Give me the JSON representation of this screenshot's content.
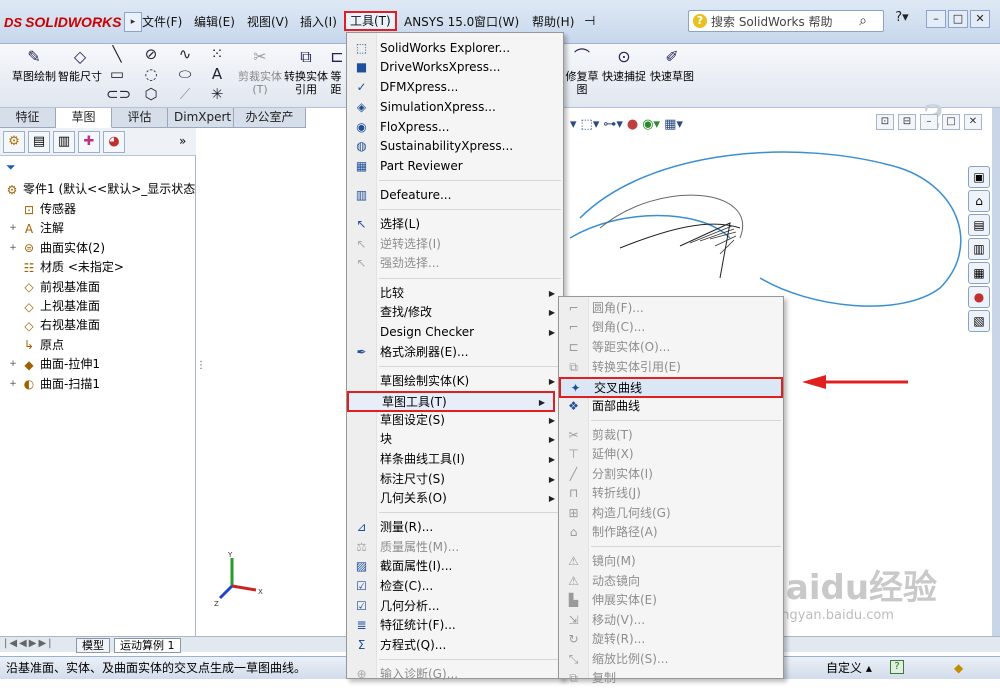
{
  "app": {
    "logo_text": "SOLIDWORKS",
    "logo_mark": "DS"
  },
  "menubar": {
    "items": [
      "文件(F)",
      "编辑(E)",
      "视图(V)",
      "插入(I)",
      "工具(T)",
      "ANSYS 15.0",
      "窗口(W)",
      "帮助(H)"
    ],
    "search_placeholder": "搜索 SolidWorks 帮助"
  },
  "command_manager": {
    "tools": [
      {
        "label": "草图绘制",
        "icon": "sketch-icon"
      },
      {
        "label": "智能尺寸",
        "icon": "smart-dimension-icon"
      },
      {
        "label": "剪裁实体(T)",
        "icon": "trim-icon"
      },
      {
        "label": "转换实体引用",
        "icon": "convert-icon"
      },
      {
        "label": "等距",
        "icon": "offset-icon"
      },
      {
        "label": "修复草图",
        "icon": "repair-sketch-icon"
      },
      {
        "label": "快速捕捉",
        "icon": "quick-snap-icon"
      },
      {
        "label": "快速草图",
        "icon": "rapid-sketch-icon"
      }
    ]
  },
  "tabs": [
    "特征",
    "草图",
    "评估",
    "DimXpert",
    "办公室产品"
  ],
  "active_tab": "草图",
  "feature_tree": {
    "root": "零件1 (默认<<默认>_显示状态",
    "items": [
      {
        "label": "传感器",
        "expand": ""
      },
      {
        "label": "注解",
        "expand": "+"
      },
      {
        "label": "曲面实体(2)",
        "expand": "+"
      },
      {
        "label": "材质 <未指定>",
        "expand": ""
      },
      {
        "label": "前视基准面",
        "expand": ""
      },
      {
        "label": "上视基准面",
        "expand": ""
      },
      {
        "label": "右视基准面",
        "expand": ""
      },
      {
        "label": "原点",
        "expand": ""
      },
      {
        "label": "曲面-拉伸1",
        "expand": "+"
      },
      {
        "label": "曲面-扫描1",
        "expand": "+"
      }
    ]
  },
  "tools_menu": {
    "items": [
      {
        "label": "SolidWorks Explorer...",
        "icon": "explorer-icon",
        "disabled": false
      },
      {
        "label": "DriveWorksXpress...",
        "icon": "driveworks-icon",
        "disabled": false
      },
      {
        "label": "DFMXpress...",
        "icon": "dfm-icon",
        "disabled": false
      },
      {
        "label": "SimulationXpress...",
        "icon": "simulation-icon",
        "disabled": false
      },
      {
        "label": "FloXpress...",
        "icon": "flo-icon",
        "disabled": false
      },
      {
        "label": "SustainabilityXpress...",
        "icon": "sustainability-icon",
        "disabled": false
      },
      {
        "label": "Part Reviewer",
        "icon": "reviewer-icon",
        "disabled": false
      },
      {
        "label": "Defeature...",
        "icon": "defeature-icon",
        "disabled": false
      },
      {
        "label": "选择(L)",
        "icon": "select-icon",
        "disabled": false
      },
      {
        "label": "逆转选择(I)",
        "icon": "invert-select-icon",
        "disabled": true
      },
      {
        "label": "强劲选择...",
        "icon": "power-select-icon",
        "disabled": true
      },
      {
        "label": "比较",
        "icon": "",
        "disabled": false
      },
      {
        "label": "查找/修改",
        "icon": "",
        "disabled": false
      },
      {
        "label": "Design Checker",
        "icon": "",
        "disabled": false
      },
      {
        "label": "格式涂刷器(E)...",
        "icon": "format-painter-icon",
        "disabled": false
      },
      {
        "label": "草图绘制实体(K)",
        "icon": "",
        "disabled": false
      },
      {
        "label": "草图工具(T)",
        "icon": "",
        "disabled": false
      },
      {
        "label": "草图设定(S)",
        "icon": "",
        "disabled": false
      },
      {
        "label": "块",
        "icon": "",
        "disabled": false
      },
      {
        "label": "样条曲线工具(I)",
        "icon": "",
        "disabled": false
      },
      {
        "label": "标注尺寸(S)",
        "icon": "",
        "disabled": false
      },
      {
        "label": "几何关系(O)",
        "icon": "",
        "disabled": false
      },
      {
        "label": "测量(R)...",
        "icon": "measure-icon",
        "disabled": false
      },
      {
        "label": "质量属性(M)...",
        "icon": "mass-props-icon",
        "disabled": true
      },
      {
        "label": "截面属性(I)...",
        "icon": "section-props-icon",
        "disabled": false
      },
      {
        "label": "检查(C)...",
        "icon": "check-icon",
        "disabled": false
      },
      {
        "label": "几何分析...",
        "icon": "geometry-analysis-icon",
        "disabled": false
      },
      {
        "label": "特征统计(F)...",
        "icon": "feature-stats-icon",
        "disabled": false
      },
      {
        "label": "方程式(Q)...",
        "icon": "equations-icon",
        "disabled": false
      },
      {
        "label": "输入诊断(G)...",
        "icon": "import-diagnostics-icon",
        "disabled": true
      }
    ]
  },
  "sketch_tools_submenu": {
    "items": [
      {
        "label": "圆角(F)...",
        "disabled": true
      },
      {
        "label": "倒角(C)...",
        "disabled": true
      },
      {
        "label": "等距实体(O)...",
        "disabled": true
      },
      {
        "label": "转换实体引用(E)",
        "disabled": true
      },
      {
        "label": "交叉曲线",
        "disabled": false
      },
      {
        "label": "面部曲线",
        "disabled": false
      },
      {
        "label": "剪裁(T)",
        "disabled": true
      },
      {
        "label": "延伸(X)",
        "disabled": true
      },
      {
        "label": "分割实体(I)",
        "disabled": true
      },
      {
        "label": "转折线(J)",
        "disabled": true
      },
      {
        "label": "构造几何线(G)",
        "disabled": true
      },
      {
        "label": "制作路径(A)",
        "disabled": true
      },
      {
        "label": "镜向(M)",
        "disabled": true
      },
      {
        "label": "动态镜向",
        "disabled": true
      },
      {
        "label": "伸展实体(E)",
        "disabled": true
      },
      {
        "label": "移动(V)...",
        "disabled": true
      },
      {
        "label": "旋转(R)...",
        "disabled": true
      },
      {
        "label": "缩放比例(S)...",
        "disabled": true
      },
      {
        "label": "复制",
        "disabled": true
      }
    ]
  },
  "bottom_tabs": [
    "模型",
    "运动算例 1"
  ],
  "statusbar": {
    "message": "沿基准面、实体、及曲面实体的交叉点生成一草图曲线。",
    "units": "自定义"
  },
  "watermark": {
    "text": "Baidu经验",
    "url": "jingyan.baidu.com"
  },
  "colors": {
    "highlight_red": "#e02020",
    "accent_blue": "#1f5fb4"
  }
}
